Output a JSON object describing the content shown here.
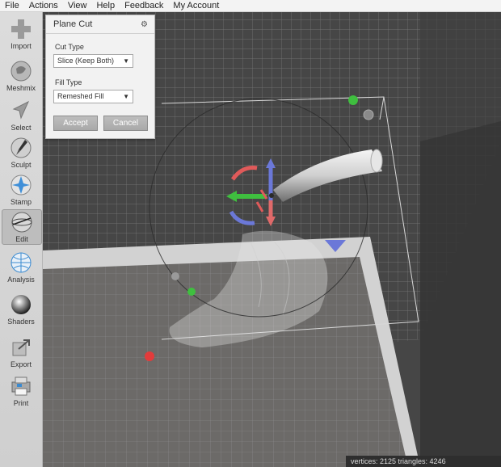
{
  "menu": [
    "File",
    "Actions",
    "View",
    "Help",
    "Feedback",
    "My Account"
  ],
  "tools": [
    {
      "id": "import",
      "label": "Import",
      "icon": "plus-icon"
    },
    {
      "id": "meshmix",
      "label": "Meshmix",
      "icon": "meshmix-icon"
    },
    {
      "id": "select",
      "label": "Select",
      "icon": "arrow-cursor-icon"
    },
    {
      "id": "sculpt",
      "label": "Sculpt",
      "icon": "brush-icon"
    },
    {
      "id": "stamp",
      "label": "Stamp",
      "icon": "stamp-icon"
    },
    {
      "id": "edit",
      "label": "Edit",
      "icon": "edit-icon",
      "active": true
    },
    {
      "id": "analysis",
      "label": "Analysis",
      "icon": "analysis-sphere-icon"
    },
    {
      "id": "shaders",
      "label": "Shaders",
      "icon": "sphere-icon"
    },
    {
      "id": "export",
      "label": "Export",
      "icon": "export-icon"
    },
    {
      "id": "print",
      "label": "Print",
      "icon": "printer-icon"
    }
  ],
  "panel": {
    "title": "Plane Cut",
    "cut_type_label": "Cut Type",
    "cut_type_value": "Slice (Keep Both)",
    "fill_type_label": "Fill Type",
    "fill_type_value": "Remeshed Fill",
    "accept_label": "Accept",
    "cancel_label": "Cancel"
  },
  "status": "vertices: 2125 triangles: 4246",
  "colors": {
    "accent_red": "#e23b3b",
    "accent_green": "#3fbf3f",
    "accent_blue": "#6b78d8",
    "panel_bg": "#f2f2f2"
  }
}
